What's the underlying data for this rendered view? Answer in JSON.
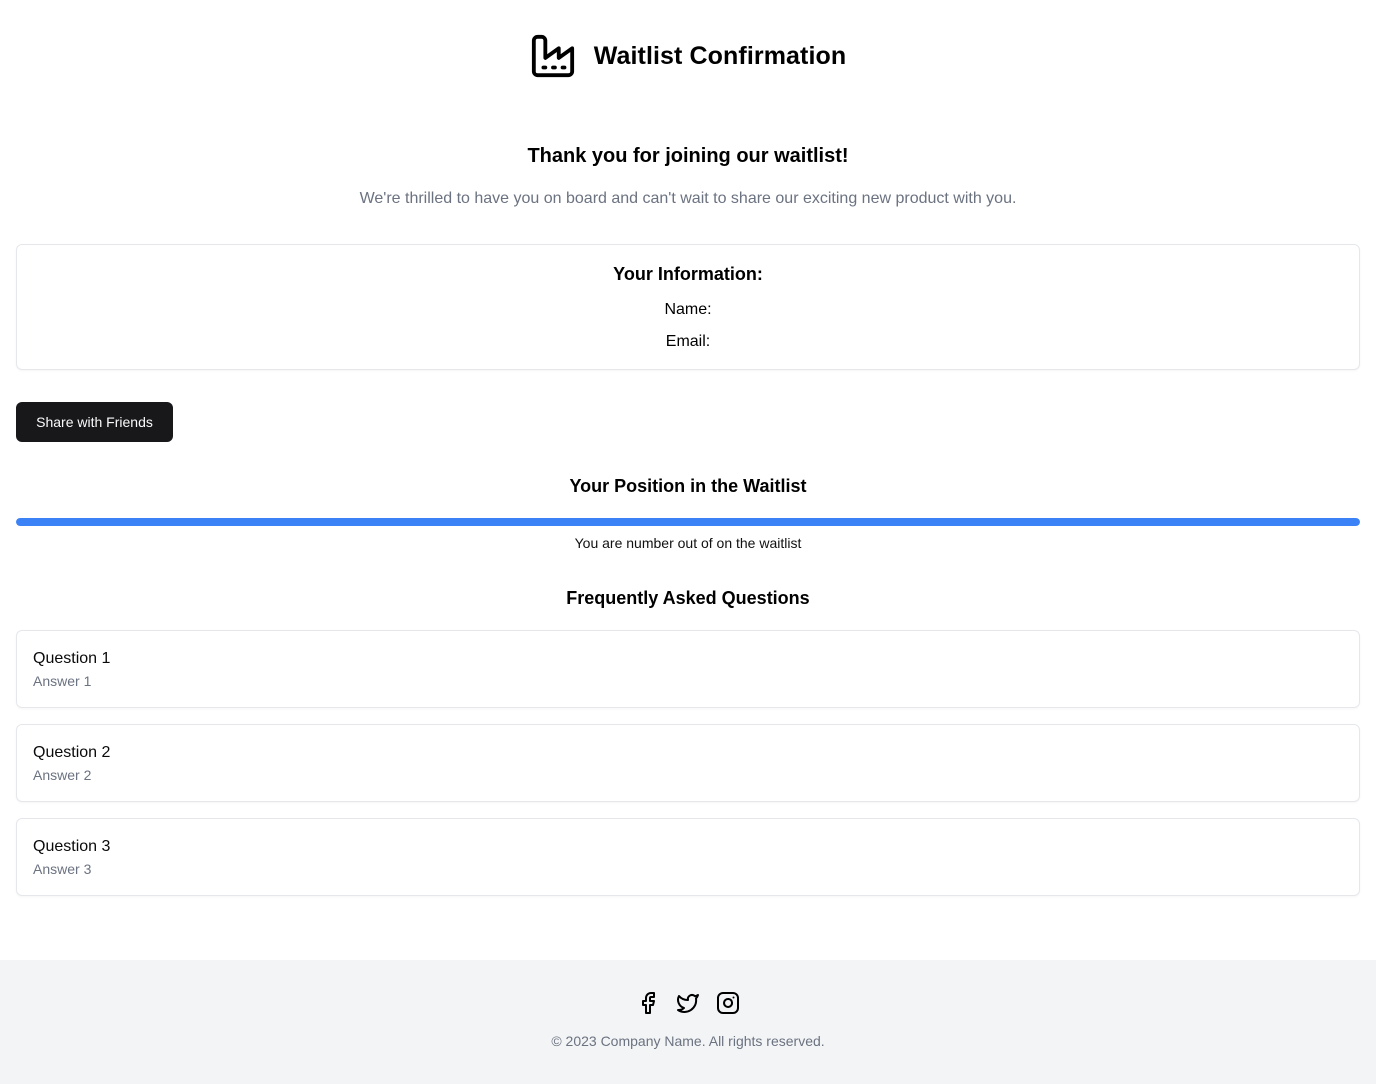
{
  "header": {
    "logo_icon": "factory-icon",
    "title": "Waitlist Confirmation"
  },
  "hero": {
    "title": "Thank you for joining our waitlist!",
    "subtitle": "We're thrilled to have you on board and can't wait to share our exciting new product with you."
  },
  "info": {
    "title": "Your Information:",
    "name_label": "Name:",
    "email_label": "Email:"
  },
  "share": {
    "label": "Share with Friends"
  },
  "position": {
    "title": "Your Position in the Waitlist",
    "progress_percent": 100,
    "progress_color": "#3b82f6",
    "text": "You are number out of on the waitlist"
  },
  "faq": {
    "title": "Frequently Asked Questions",
    "items": [
      {
        "question": "Question 1",
        "answer": "Answer 1"
      },
      {
        "question": "Question 2",
        "answer": "Answer 2"
      },
      {
        "question": "Question 3",
        "answer": "Answer 3"
      }
    ]
  },
  "footer": {
    "social": [
      "facebook-icon",
      "twitter-icon",
      "instagram-icon"
    ],
    "copyright": "© 2023 Company Name. All rights reserved.",
    "background": "#f3f4f6"
  },
  "colors": {
    "primary_button": "#18181b",
    "muted_text": "#6b7280",
    "border": "#e5e7eb"
  }
}
